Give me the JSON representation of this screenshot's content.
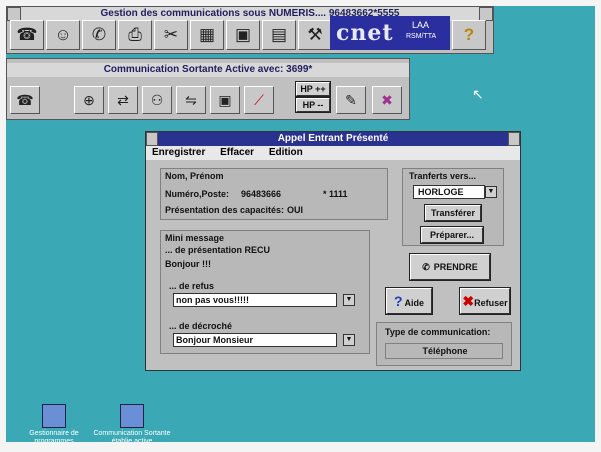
{
  "main_window": {
    "title": "Gestion des communications sous NUMERIS.... 96483662*5555",
    "cnet": {
      "logo": "cnet",
      "lab": "LAA",
      "dept": "RSM/TTA"
    }
  },
  "sub_window": {
    "title": "Communication Sortante Active avec: 3699*",
    "hp_plus": "HP ++",
    "hp_minus": "HP --"
  },
  "dialog": {
    "title": "Appel Entrant Présenté",
    "menu": [
      "Enregistrer",
      "Effacer",
      "Edition"
    ],
    "caller": {
      "name_label": "Nom, Prénom",
      "number_label": "Numéro,Poste:",
      "number_value": "96483666",
      "extension": "* 1111",
      "capabilities_label": "Présentation des capacités:",
      "capabilities_value": "OUI"
    },
    "mini_message": {
      "title": "Mini message",
      "presentation_label": "... de présentation RECU",
      "presentation_text": "Bonjour !!!",
      "refus_label": "... de refus",
      "refus_value": "non pas vous!!!!!",
      "decroche_label": "... de décroché",
      "decroche_value": "Bonjour Monsieur"
    },
    "transfer": {
      "label": "Tranferts vers...",
      "selected": "HORLOGE",
      "transferer": "Transférer",
      "preparer": "Préparer..."
    },
    "prendre": "PRENDRE",
    "aide": "Aide",
    "refuser": "Refuser",
    "comm_type": {
      "label": "Type de communication:",
      "value": "Téléphone"
    }
  },
  "desktop": [
    {
      "label": "Gestionnaire de programmes"
    },
    {
      "label": "Communication Sortante établie active"
    }
  ],
  "colors": {
    "desktop": "#3aa9b5",
    "dialog_caption": "#2a3290",
    "cnet_banner": "#2a2e9e"
  }
}
